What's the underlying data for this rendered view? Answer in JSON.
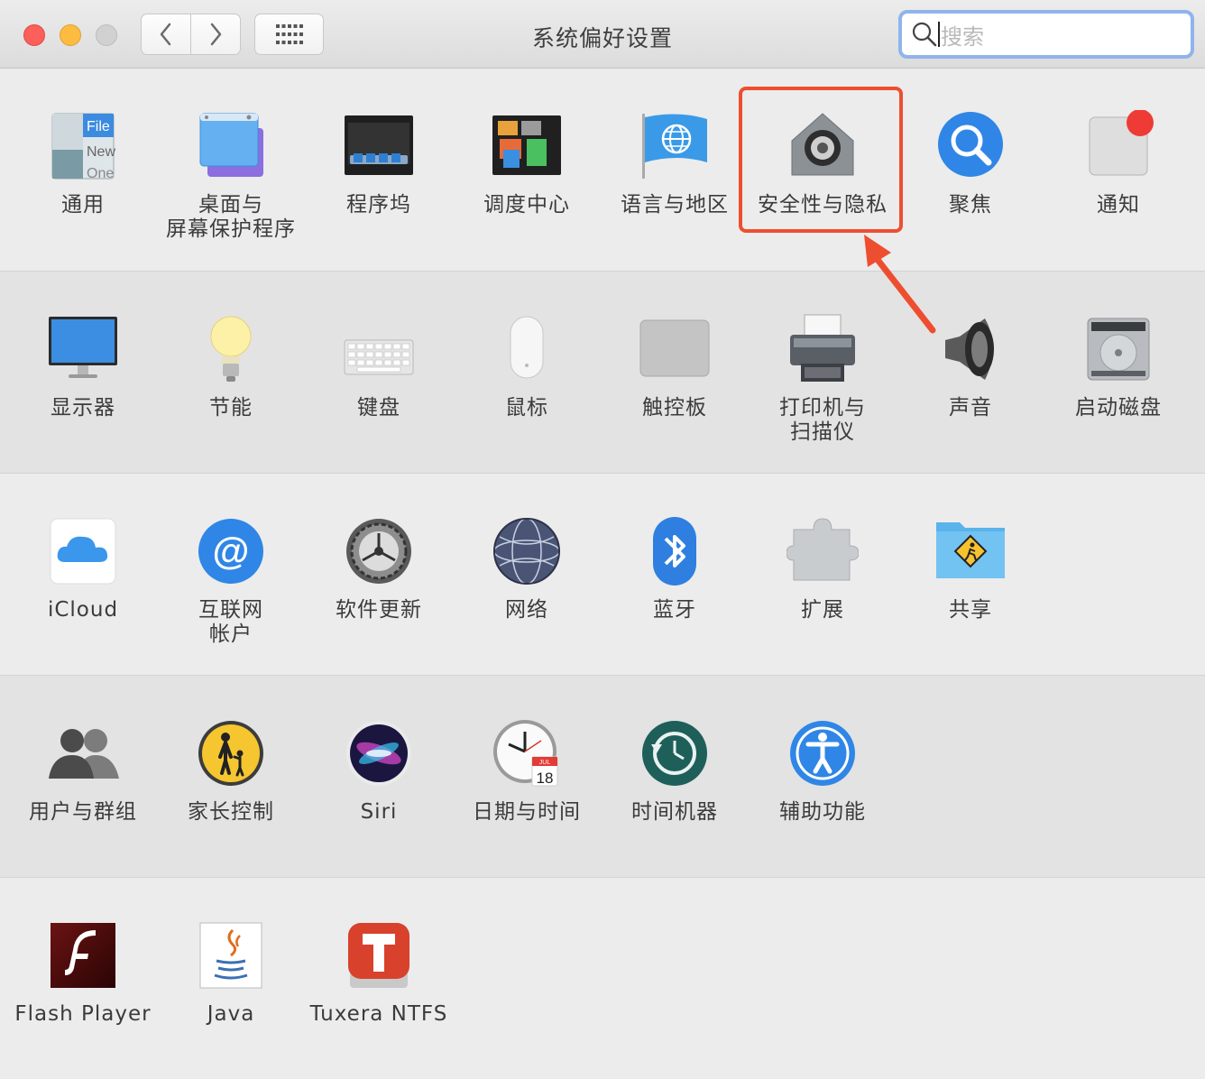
{
  "window": {
    "title": "系统偏好设置"
  },
  "search": {
    "placeholder": "搜索"
  },
  "sections": [
    [
      {
        "label": "通用",
        "icon": "general-icon"
      },
      {
        "label": "桌面与\n屏幕保护程序",
        "icon": "desktop-screensaver-icon"
      },
      {
        "label": "程序坞",
        "icon": "dock-icon"
      },
      {
        "label": "调度中心",
        "icon": "mission-control-icon"
      },
      {
        "label": "语言与地区",
        "icon": "language-region-icon"
      },
      {
        "label": "安全性与隐私",
        "icon": "security-privacy-icon"
      },
      {
        "label": "聚焦",
        "icon": "spotlight-icon"
      },
      {
        "label": "通知",
        "icon": "notifications-icon"
      }
    ],
    [
      {
        "label": "显示器",
        "icon": "displays-icon"
      },
      {
        "label": "节能",
        "icon": "energy-saver-icon"
      },
      {
        "label": "键盘",
        "icon": "keyboard-icon"
      },
      {
        "label": "鼠标",
        "icon": "mouse-icon"
      },
      {
        "label": "触控板",
        "icon": "trackpad-icon"
      },
      {
        "label": "打印机与\n扫描仪",
        "icon": "printer-scanner-icon"
      },
      {
        "label": "声音",
        "icon": "sound-icon"
      },
      {
        "label": "启动磁盘",
        "icon": "startup-disk-icon"
      }
    ],
    [
      {
        "label": "iCloud",
        "icon": "icloud-icon"
      },
      {
        "label": "互联网\n帐户",
        "icon": "internet-accounts-icon"
      },
      {
        "label": "软件更新",
        "icon": "software-update-icon"
      },
      {
        "label": "网络",
        "icon": "network-icon"
      },
      {
        "label": "蓝牙",
        "icon": "bluetooth-icon"
      },
      {
        "label": "扩展",
        "icon": "extensions-icon"
      },
      {
        "label": "共享",
        "icon": "sharing-icon"
      }
    ],
    [
      {
        "label": "用户与群组",
        "icon": "users-groups-icon"
      },
      {
        "label": "家长控制",
        "icon": "parental-controls-icon"
      },
      {
        "label": "Siri",
        "icon": "siri-icon"
      },
      {
        "label": "日期与时间",
        "icon": "date-time-icon"
      },
      {
        "label": "时间机器",
        "icon": "time-machine-icon"
      },
      {
        "label": "辅助功能",
        "icon": "accessibility-icon"
      }
    ],
    [
      {
        "label": "Flash Player",
        "icon": "flash-player-icon"
      },
      {
        "label": "Java",
        "icon": "java-icon"
      },
      {
        "label": "Tuxera NTFS",
        "icon": "tuxera-ntfs-icon"
      }
    ]
  ],
  "general_icon_text": [
    "File",
    "New",
    "One"
  ],
  "date_icon": {
    "month": "JUL",
    "day": "18"
  },
  "annotation": {
    "color": "#ee4e30",
    "highlighted": "安全性与隐私"
  }
}
